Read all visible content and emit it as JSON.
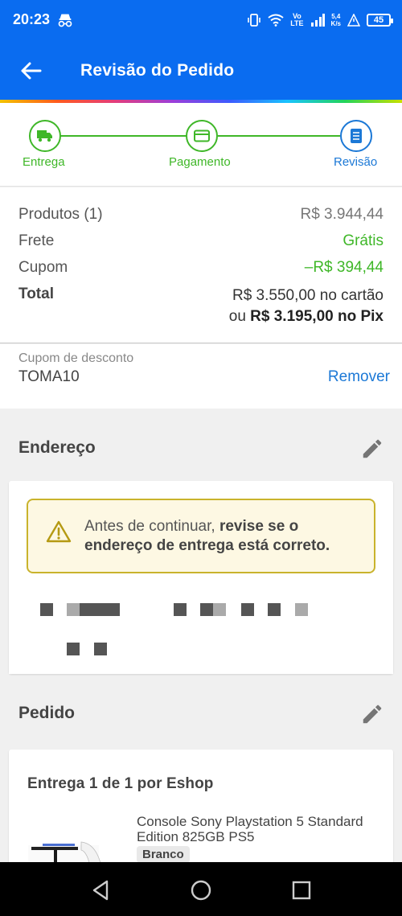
{
  "status_bar": {
    "time": "20:23",
    "lte_top": "Vo",
    "lte_bottom": "LTE",
    "speed_top": "5,4",
    "speed_bottom": "K/s",
    "battery": "45"
  },
  "app_bar": {
    "title": "Revisão do Pedido"
  },
  "stepper": {
    "steps": [
      {
        "label": "Entrega",
        "icon": "truck-icon",
        "state": "done"
      },
      {
        "label": "Pagamento",
        "icon": "card-icon",
        "state": "done"
      },
      {
        "label": "Revisão",
        "icon": "document-icon",
        "state": "current"
      }
    ]
  },
  "summary": {
    "products_label": "Produtos (1)",
    "products_value": "R$ 3.944,44",
    "shipping_label": "Frete",
    "shipping_value": "Grátis",
    "coupon_label": "Cupom",
    "coupon_value": "–R$ 394,44",
    "total_label": "Total",
    "total_card": "R$ 3.550,00 no cartão",
    "total_pix_prefix": "ou ",
    "total_pix": "R$ 3.195,00 no Pix"
  },
  "coupon": {
    "label": "Cupom de desconto",
    "code": "TOMA10",
    "remove": "Remover"
  },
  "address": {
    "title": "Endereço",
    "warning_prefix": "Antes de continuar, ",
    "warning_bold": "revise se o endereço de entrega está correto."
  },
  "order": {
    "title": "Pedido",
    "delivery_heading": "Entrega 1 de 1 por Eshop",
    "product_name": "Console Sony Playstation 5 Standard Edition 825GB PS5",
    "product_color": "Branco"
  },
  "colors": {
    "brand_blue": "#0a6cf0",
    "success_green": "#3fb728",
    "link_blue": "#1b78d6",
    "warning_border": "#c9b32c"
  }
}
